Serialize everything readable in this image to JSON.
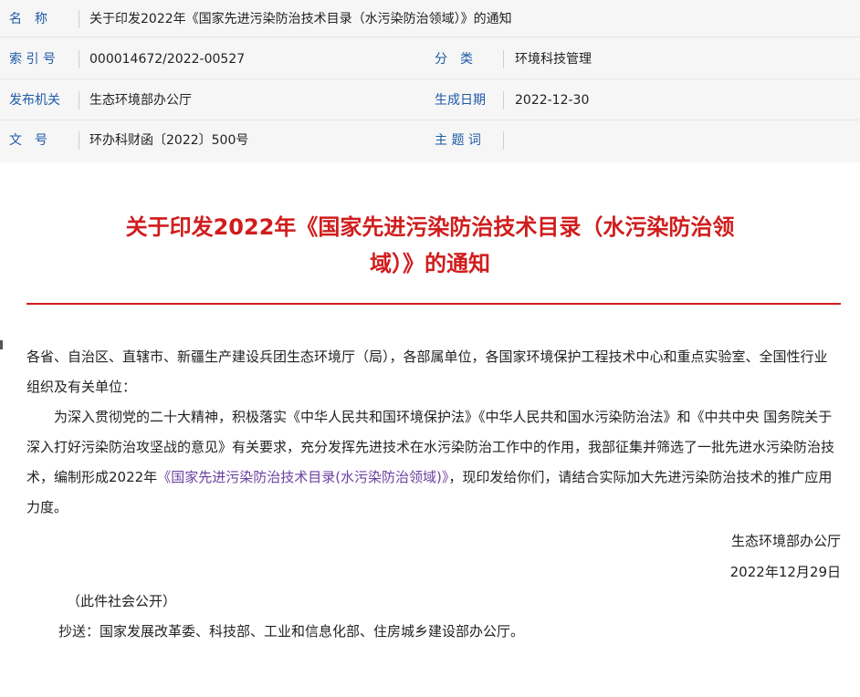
{
  "meta": {
    "name_label": "名　称",
    "name_value": "关于印发2022年《国家先进污染防治技术目录（水污染防治领域）》的通知",
    "index_label": "索 引 号",
    "index_value": "000014672/2022-00527",
    "category_label": "分　类",
    "category_value": "环境科技管理",
    "issuer_label": "发布机关",
    "issuer_value": "生态环境部办公厅",
    "date_label": "生成日期",
    "date_value": "2022-12-30",
    "docno_label": "文　号",
    "docno_value": "环办科财函〔2022〕500号",
    "keyword_label": "主 题 词",
    "keyword_value": ""
  },
  "title": {
    "line1": "关于印发2022年《国家先进污染防治技术目录（水污染防治领",
    "line2": "域）》的通知"
  },
  "body": {
    "addressee": "各省、自治区、直辖市、新疆生产建设兵团生态环境厅（局），各部属单位，各国家环境保护工程技术中心和重点实验室、全国性行业组织及有关单位：",
    "para_before_link": "为深入贯彻党的二十大精神，积极落实《中华人民共和国环境保护法》《中华人民共和国水污染防治法》和《中共中央 国务院关于深入打好污染防治攻坚战的意见》有关要求，充分发挥先进技术在水污染防治工作中的作用，我部征集并筛选了一批先进水污染防治技术，编制形成2022年",
    "link_text": "《国家先进污染防治技术目录(水污染防治领域)》",
    "para_after_link": "，现印发给你们，请结合实际加大先进污染防治技术的推广应用力度。",
    "signer": "生态环境部办公厅",
    "sign_date": "2022年12月29日",
    "public_note": "（此件社会公开）",
    "cc": "抄送：国家发展改革委、科技部、工业和信息化部、住房城乡建设部办公厅。"
  }
}
